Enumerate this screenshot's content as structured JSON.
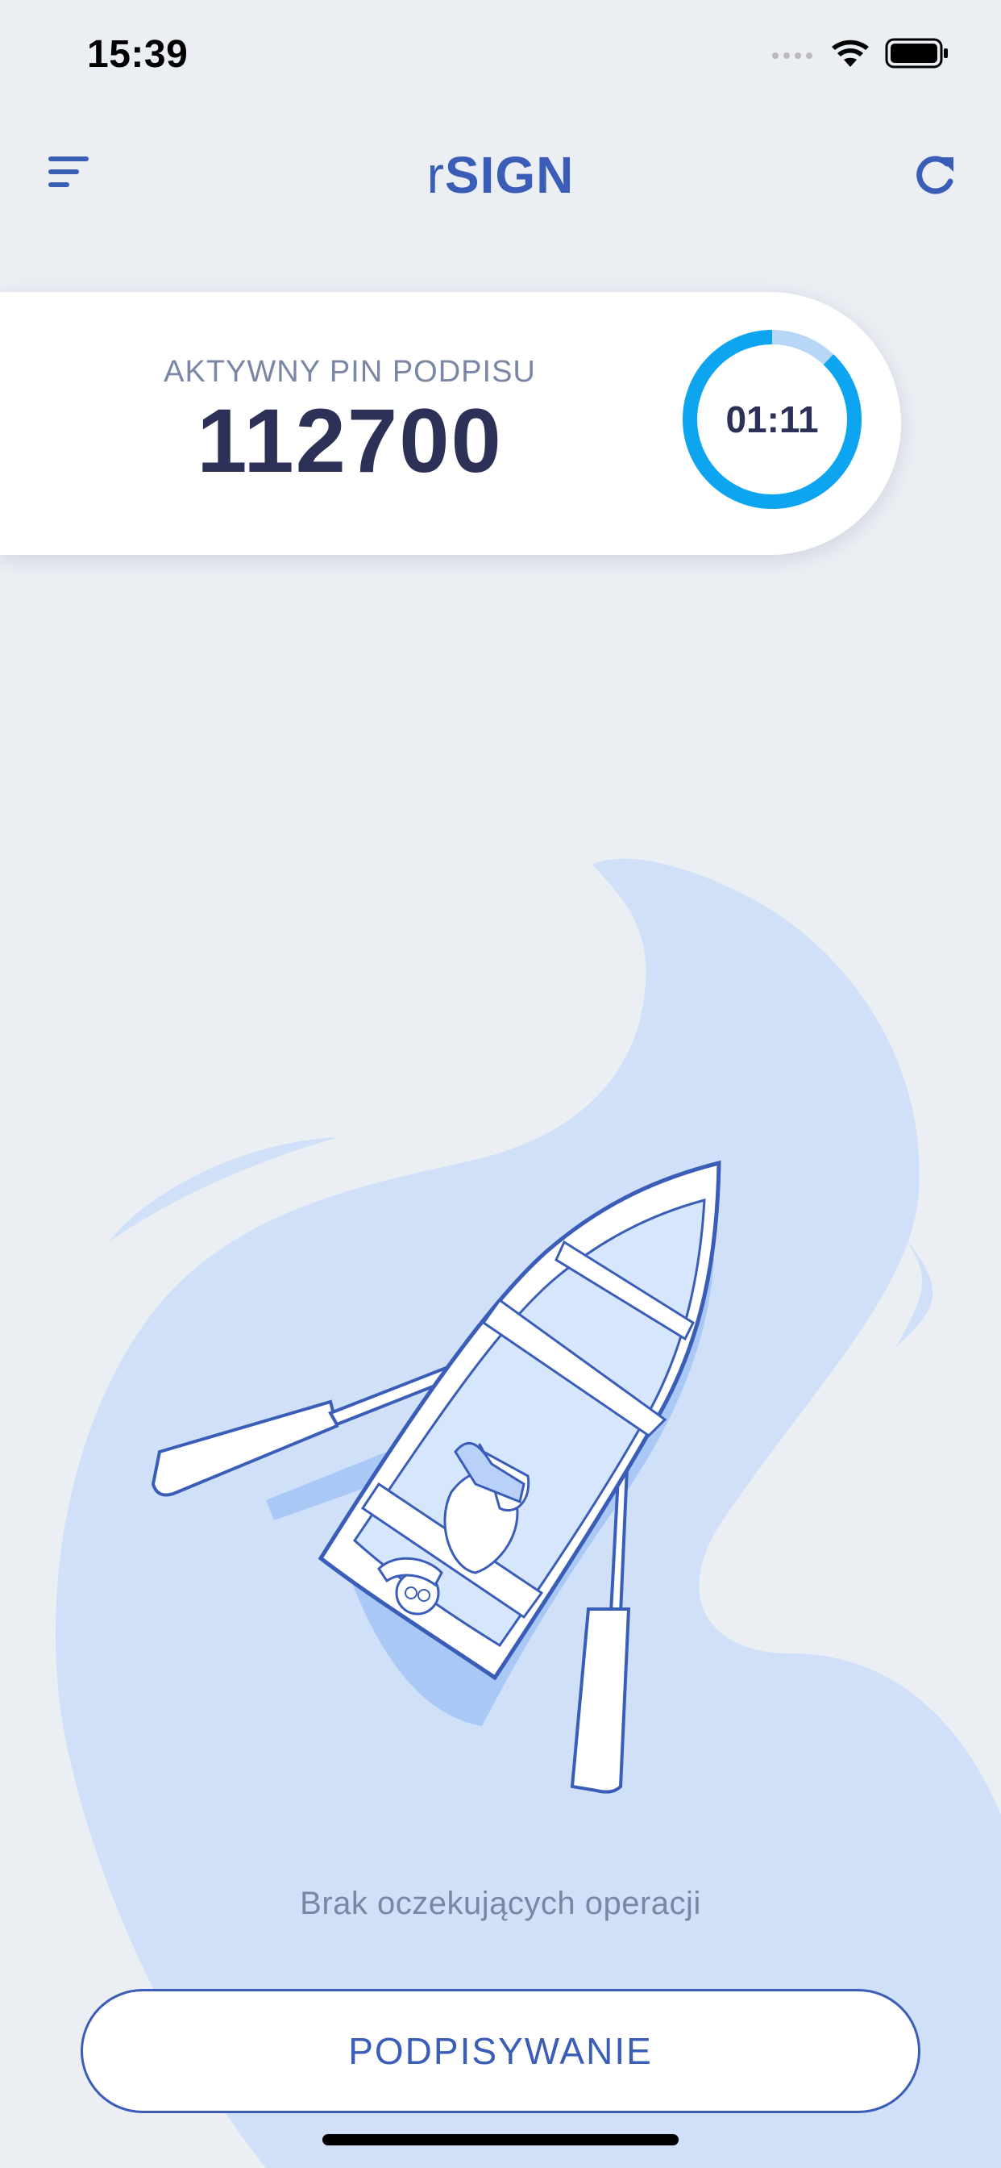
{
  "status_bar": {
    "time": "15:39",
    "icons": [
      "signal-icon",
      "wifi-icon",
      "battery-icon"
    ]
  },
  "header": {
    "title_prefix": "r",
    "title_main": "SIGN",
    "menu_icon": "menu-icon",
    "refresh_icon": "refresh-icon"
  },
  "pin_card": {
    "label": "AKTYWNY PIN PODPISU",
    "pin": "112700",
    "timer": "01:11",
    "timer_remaining_fraction": 0.88
  },
  "main": {
    "empty_message": "Brak oczekujących operacji"
  },
  "actions": {
    "sign_button_label": "PODPISYWANIE"
  },
  "colors": {
    "accent": "#3a5db8",
    "pin_text": "#2d3158",
    "timer_ring": "#0ea5f0",
    "timer_track": "#b8d6f8",
    "background": "#ebeef3",
    "illustration_water": "#cfe0f8"
  }
}
